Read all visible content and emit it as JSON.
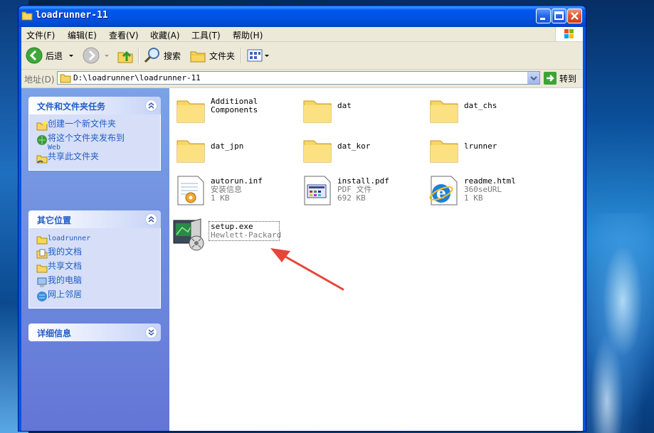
{
  "window": {
    "title": "loadrunner-11"
  },
  "menu": [
    {
      "label": "文件(F)"
    },
    {
      "label": "编辑(E)"
    },
    {
      "label": "查看(V)"
    },
    {
      "label": "收藏(A)"
    },
    {
      "label": "工具(T)"
    },
    {
      "label": "帮助(H)"
    }
  ],
  "toolbar": {
    "back_label": "后退",
    "search_label": "搜索",
    "folders_label": "文件夹"
  },
  "address": {
    "label": "地址(D)",
    "value": "D:\\loadrunner\\loadrunner-11",
    "go_label": "转到"
  },
  "sidebar": {
    "tasks": {
      "title": "文件和文件夹任务",
      "items": [
        {
          "label": "创建一个新文件夹",
          "icon": "new-folder-icon"
        },
        {
          "label": "将这个文件夹发布到",
          "label2": "Web",
          "icon": "publish-web-icon"
        },
        {
          "label": "共享此文件夹",
          "icon": "share-folder-icon"
        }
      ]
    },
    "places": {
      "title": "其它位置",
      "items": [
        {
          "label": "loadrunner",
          "icon": "folder-icon"
        },
        {
          "label": "我的文档",
          "icon": "my-documents-icon"
        },
        {
          "label": "共享文档",
          "icon": "shared-documents-icon"
        },
        {
          "label": "我的电脑",
          "icon": "my-computer-icon"
        },
        {
          "label": "网上邻居",
          "icon": "network-places-icon"
        }
      ]
    },
    "details": {
      "title": "详细信息"
    }
  },
  "files": [
    {
      "name": "Additional",
      "name2": "Components",
      "type": "folder"
    },
    {
      "name": "dat",
      "type": "folder"
    },
    {
      "name": "dat_chs",
      "type": "folder"
    },
    {
      "name": "dat_jpn",
      "type": "folder"
    },
    {
      "name": "dat_kor",
      "type": "folder"
    },
    {
      "name": "lrunner",
      "type": "folder"
    },
    {
      "name": "autorun.inf",
      "desc": "安装信息",
      "size": "1 KB",
      "type": "inf"
    },
    {
      "name": "install.pdf",
      "desc": "PDF 文件",
      "size": "692 KB",
      "type": "pdf"
    },
    {
      "name": "readme.html",
      "desc": "360seURL",
      "size": "1 KB",
      "type": "html"
    },
    {
      "name": "setup.exe",
      "desc": "Hewlett-Packard",
      "type": "exe",
      "selected": true
    }
  ],
  "colors": {
    "titlebar": "#0054e3",
    "sidebar": "#7ba2e7",
    "link": "#215dc6",
    "arrow": "#e8453a"
  }
}
